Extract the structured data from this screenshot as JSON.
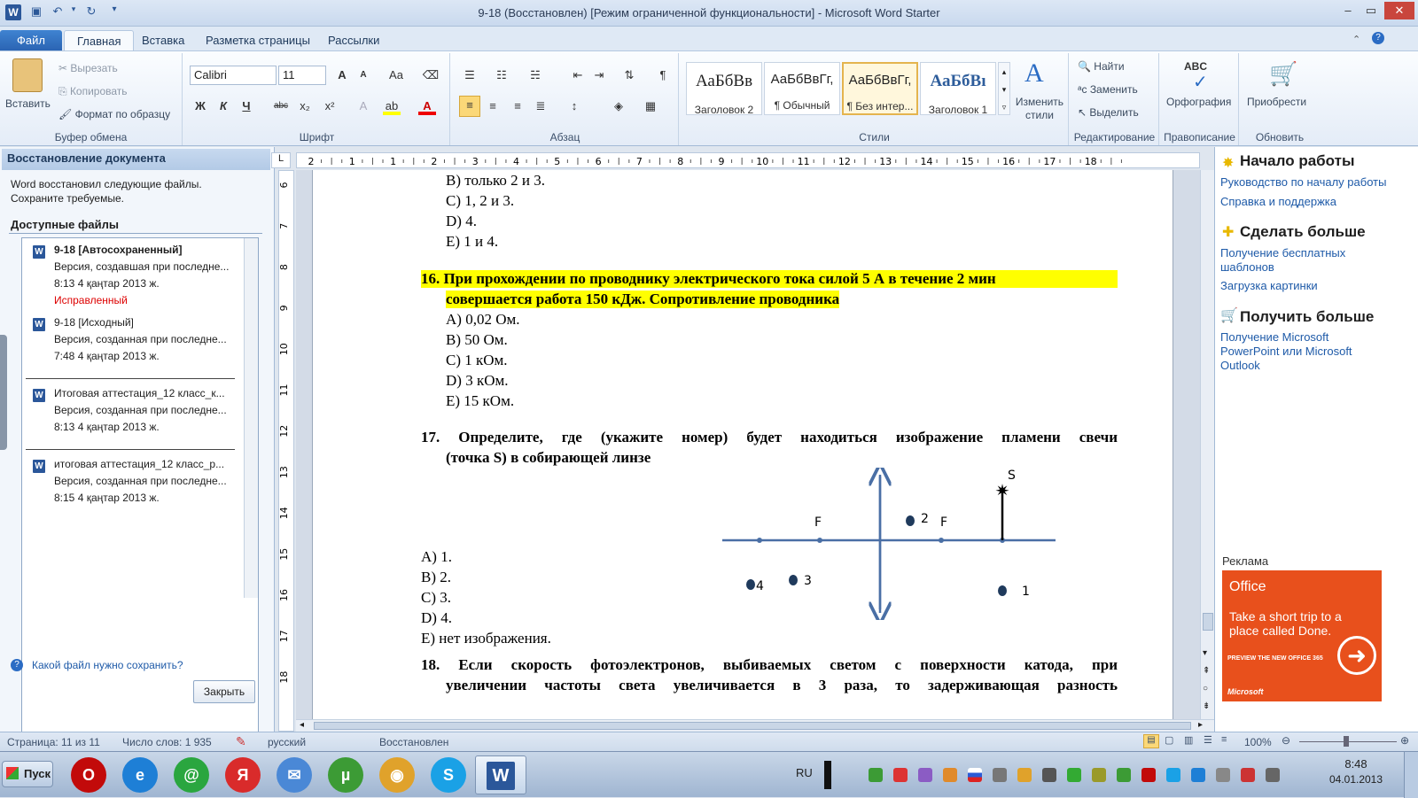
{
  "window": {
    "title": "9-18 (Восстановлен) [Режим ограниченной функциональности] - Microsoft Word Starter",
    "app_icon": "W"
  },
  "tabs": [
    "Файл",
    "Главная",
    "Вставка",
    "Разметка страницы",
    "Рассылки"
  ],
  "ribbon": {
    "clipboard": {
      "paste": "Вставить",
      "cut": "Вырезать",
      "copy": "Копировать",
      "format_painter": "Формат по образцу",
      "label": "Буфер обмена"
    },
    "font": {
      "family": "Calibri",
      "size": "11",
      "label": "Шрифт",
      "grow": "A",
      "shrink": "A",
      "case": "Aa",
      "bold": "Ж",
      "italic": "К",
      "underline": "Ч",
      "strike": "abc",
      "sub": "x₂",
      "sup": "x²"
    },
    "paragraph": {
      "label": "Абзац",
      "pilcrow": "¶"
    },
    "styles": {
      "label": "Стили",
      "items": [
        {
          "preview": "АаБбВв",
          "name": "Заголовок 2"
        },
        {
          "preview": "АаБбВвГг,",
          "name": "¶ Обычный"
        },
        {
          "preview": "АаБбВвГг,",
          "name": "¶ Без интер..."
        },
        {
          "preview": "АаБбВı",
          "name": "Заголовок 1"
        }
      ],
      "change": "Изменить стили"
    },
    "editing": {
      "label": "Редактирование",
      "find": "Найти",
      "replace": "Заменить",
      "select": "Выделить"
    },
    "proofing": {
      "label": "Правописание",
      "spelling": "Орфография",
      "abc": "ABC"
    },
    "update": {
      "label": "Обновить",
      "button": "Приобрести"
    }
  },
  "recovery": {
    "header": "Восстановление документа",
    "message": "Word восстановил следующие файлы. Сохраните требуемые.",
    "available": "Доступные файлы",
    "files": [
      {
        "name": "9-18  [Автосохраненный]",
        "version": "Версия, создавшая при последне...",
        "time": "8:13 4 қаңтар 2013 ж.",
        "status": "Исправленный"
      },
      {
        "name": "9-18  [Исходный]",
        "version": "Версия, созданная при последне...",
        "time": "7:48 4 қаңтар 2013 ж.",
        "status": ""
      },
      {
        "name": "Итоговая аттестация_12 класс_к...",
        "version": "Версия, созданная при последне...",
        "time": "8:13 4 қаңтар 2013 ж.",
        "status": ""
      },
      {
        "name": "итоговая аттестация_12 класс_р...",
        "version": "Версия, созданная при последне...",
        "time": "8:15 4 қаңтар 2013 ж.",
        "status": ""
      }
    ],
    "help": "Какой файл нужно сохранить?",
    "close": "Закрыть"
  },
  "ruler": {
    "h_marks": [
      "2",
      "1",
      "1",
      "2",
      "3",
      "4",
      "5",
      "6",
      "7",
      "8",
      "9",
      "10",
      "11",
      "12",
      "13",
      "14",
      "15",
      "16",
      "17",
      "18"
    ],
    "v_marks": [
      "6",
      "7",
      "8",
      "9",
      "10",
      "11",
      "12",
      "13",
      "14",
      "15",
      "16",
      "17",
      "18"
    ],
    "corner": "L"
  },
  "document": {
    "q15_options": [
      "B) только 2 и 3.",
      "C) 1, 2 и 3.",
      "D) 4.",
      "E) 1 и 4."
    ],
    "q16_num": "16.",
    "q16_line1": "При прохождении по проводнику электрического тока силой 5 А в течение 2 мин",
    "q16_line2": "совершается работа 150 кДж. Сопротивление проводника",
    "q16_options": [
      "A) 0,02 Ом.",
      "B) 50 Ом.",
      "C) 1 кОм.",
      "D) 3 кОм.",
      "E) 15 кОм."
    ],
    "q17_num": "17.",
    "q17_line1": "Определите, где (укажите номер) будет находиться изображение пламени свечи",
    "q17_line2": "(точка S) в собирающей линзе",
    "q17_options": [
      "A)  1.",
      "B)  2.",
      "C)  3.",
      "D)  4.",
      "E)  нет изображения."
    ],
    "diagram": {
      "s": "S",
      "f_left": "F",
      "f_right": "F",
      "p1": "1",
      "p2": "2",
      "p3": "3",
      "p4": "4"
    },
    "q18_num": "18.",
    "q18_line1": "Если скорость фотоэлектронов, выбиваемых светом с поверхности катода, при",
    "q18_line2": "увеличении частоты света увеличивается в 3 раза, то задерживающая разность"
  },
  "rightpane": {
    "start": "Начало работы",
    "start_links": [
      "Руководство по началу работы",
      "Справка и поддержка"
    ],
    "more": "Сделать больше",
    "more_links": [
      "Получение бесплатных шаблонов",
      "Загрузка картинки"
    ],
    "get": "Получить больше",
    "get_links": [
      "Получение Microsoft PowerPoint или Microsoft Outlook"
    ],
    "ad_label": "Реклама",
    "ad": {
      "brand": "Office",
      "text": "Take a short trip to a place called Done.",
      "cta": "PREVIEW THE NEW OFFICE 365",
      "footer": "Microsoft",
      "color": "#e8501c"
    }
  },
  "status": {
    "page": "Страница: 11 из 11",
    "words": "Число слов: 1 935",
    "lang": "русский",
    "state": "Восстановлен",
    "zoom": "100%"
  },
  "taskbar": {
    "start": "Пуск",
    "lang": "RU",
    "time": "8:48",
    "date": "04.01.2013"
  }
}
